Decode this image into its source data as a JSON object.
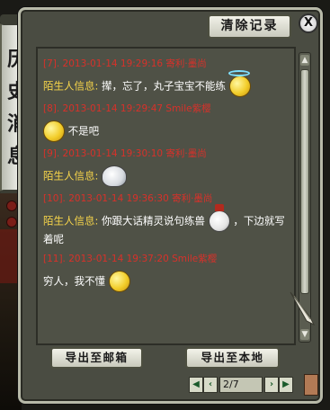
{
  "banner": {
    "chars": [
      "历",
      "史",
      "消",
      "息"
    ]
  },
  "toolbar": {
    "clear_label": "清除记录",
    "close_label": "X"
  },
  "messages": [
    {
      "ts": "[7]. 2013-01-14 19:29:16 寄利·墨尚",
      "sender": "陌生人信息:",
      "text": "撵，忘了，丸子宝宝不能练",
      "emote": "halo-smiley-icon"
    },
    {
      "ts": "[8]. 2013-01-14 19:29:47 Smile紫樱",
      "sender": "",
      "text": "不是吧",
      "emote": "blush-smiley-icon"
    },
    {
      "ts": "[9]. 2013-01-14 19:30:10 寄利·墨尚",
      "sender": "陌生人信息:",
      "text": "",
      "emote": "cloud-icon"
    },
    {
      "ts": "[10]. 2013-01-14 19:36:30 寄利·墨尚",
      "sender": "陌生人信息:",
      "text": "你跟大话精灵说句练兽",
      "text2": "，下边就写着呢",
      "emote": "hat-smiley-icon"
    },
    {
      "ts": "[11]. 2013-01-14 19:37:20 Smile紫樱",
      "sender": "",
      "text": "穷人，我不懂",
      "emote": "sweat-smiley-icon"
    }
  ],
  "buttons": {
    "export_mail": "导出至邮箱",
    "export_local": "导出至本地"
  },
  "pager": {
    "value": "2/7"
  },
  "colors": {
    "timestamp": "#d8312a",
    "sender": "#f4d34a",
    "text": "#ffffff"
  }
}
